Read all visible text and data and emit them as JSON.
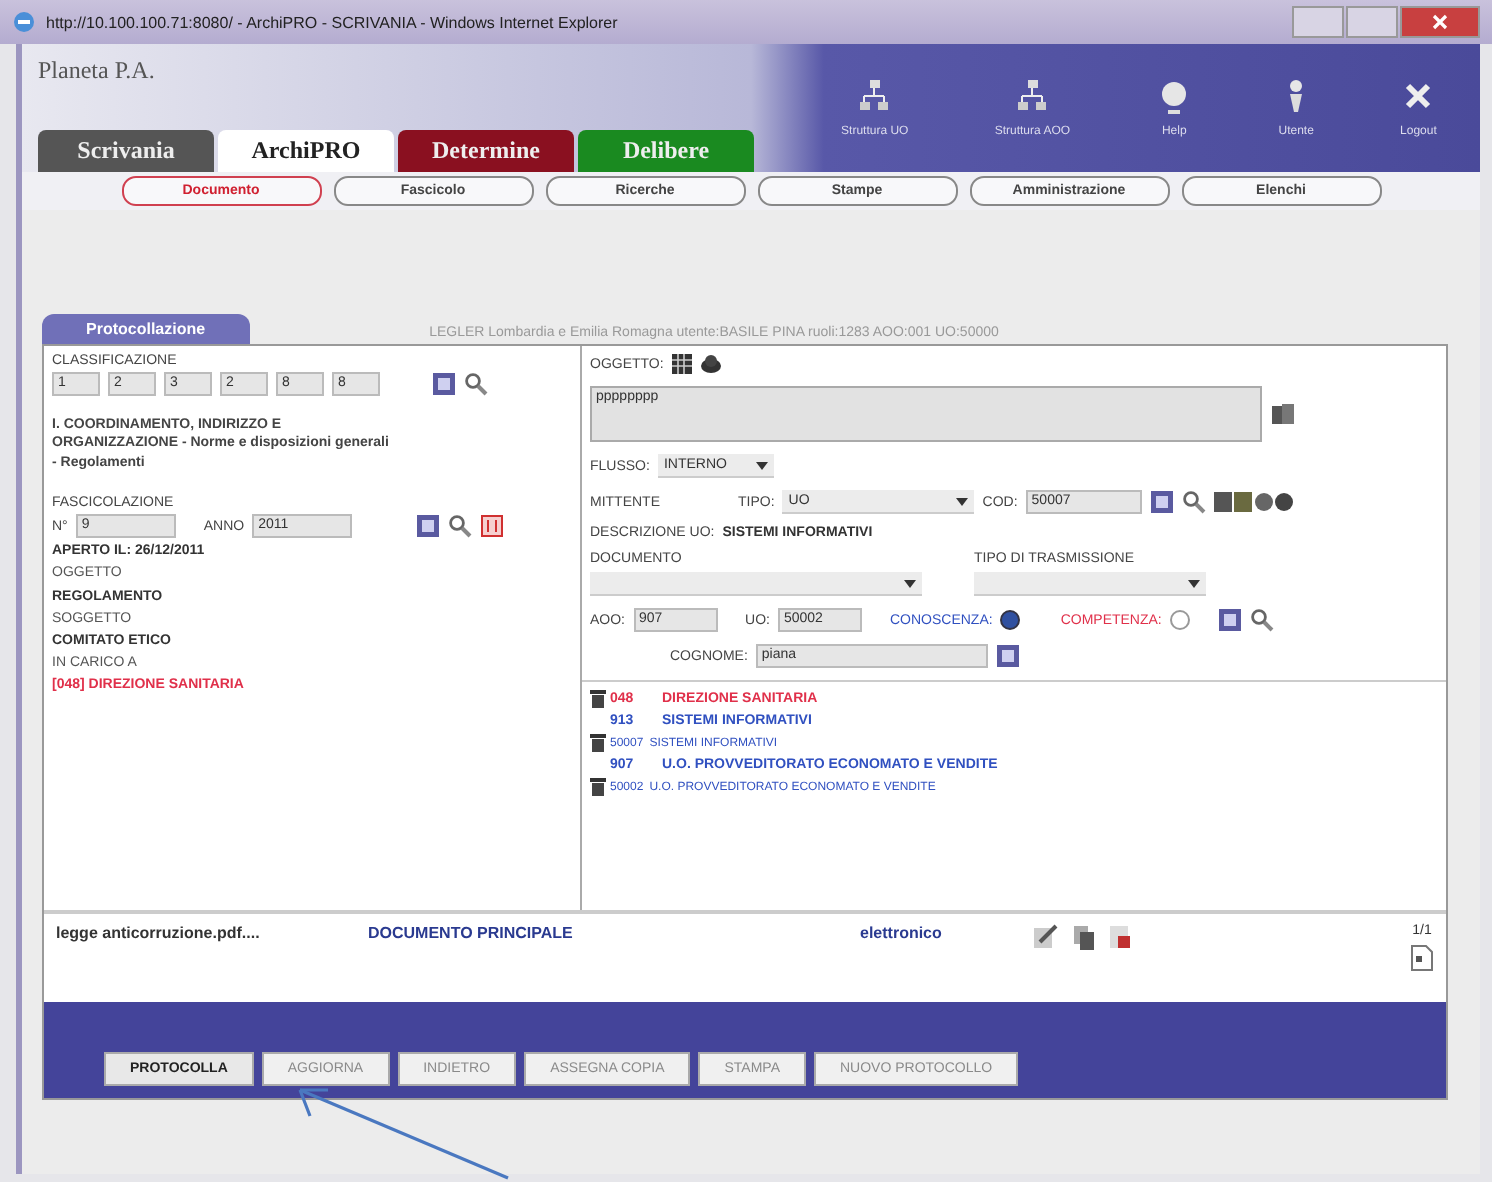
{
  "window": {
    "title": "http://10.100.100.71:8080/ - ArchiPRO - SCRIVANIA - Windows Internet Explorer"
  },
  "brand": "Planeta P.A.",
  "modules": [
    {
      "label": "Scrivania",
      "kind": "grey",
      "selected": false
    },
    {
      "label": "ArchiPRO",
      "kind": "grey",
      "selected": true
    },
    {
      "label": "Determine",
      "kind": "red",
      "selected": false
    },
    {
      "label": "Delibere",
      "kind": "green",
      "selected": false
    }
  ],
  "tools": [
    {
      "label": "Struttura UO",
      "kind": "tree"
    },
    {
      "label": "Struttura AOO",
      "kind": "tree"
    },
    {
      "label": "Help",
      "kind": "help"
    },
    {
      "label": "Utente",
      "kind": "user"
    },
    {
      "label": "Logout",
      "kind": "close"
    }
  ],
  "nav": [
    {
      "label": "Documento",
      "selected": true
    },
    {
      "label": "Fascicolo",
      "selected": false
    },
    {
      "label": "Ricerche",
      "selected": false
    },
    {
      "label": "Stampe",
      "selected": false
    },
    {
      "label": "Amministrazione",
      "selected": false
    },
    {
      "label": "Elenchi",
      "selected": false
    }
  ],
  "panel_tab": "Protocollazione",
  "info_line": "LEGLER Lombardia e Emilia Romagna  utente:BASILE PINA  ruoli:1283 AOO:001 UO:50000",
  "left": {
    "classificazione_label": "CLASSIFICAZIONE",
    "classificazione": [
      "1",
      "2",
      "3",
      "2",
      "8",
      "8"
    ],
    "classificazione_text": "I. COORDINAMENTO, INDIRIZZO E ORGANIZZAZIONE - Norme e disposizioni generali - Regolamenti",
    "fascicolazione_label": "FASCICOLAZIONE",
    "numero_label": "N°",
    "numero": "9",
    "anno_label": "ANNO",
    "anno": "2011",
    "details": [
      {
        "text": "APERTO IL: 26/12/2011",
        "kind": "bold"
      },
      {
        "text": "OGGETTO",
        "kind": "plain"
      },
      {
        "text": "REGOLAMENTO",
        "kind": "bold"
      },
      {
        "text": "SOGGETTO",
        "kind": "plain"
      },
      {
        "text": "COMITATO ETICO",
        "kind": "bold"
      },
      {
        "text": "IN CARICO A",
        "kind": "plain"
      },
      {
        "text": "[048] DIREZIONE SANITARIA",
        "kind": "alert"
      }
    ]
  },
  "right": {
    "oggetto_label": "OGGETTO:",
    "oggetto": "pppppppp",
    "flusso_label": "FLUSSO:",
    "flusso": "INTERNO",
    "mittente_label": "MITTENTE",
    "tipo_label": "TIPO:",
    "tipo": "UO",
    "cod_label": "COD:",
    "cod": "50007",
    "descrizione_label": "DESCRIZIONE UO:",
    "descrizione": "SISTEMI INFORMATIVI",
    "documento_label": "DOCUMENTO",
    "trasmissione_label": "TIPO DI TRASMISSIONE",
    "aoo_label": "AOO:",
    "aoo": "907",
    "uo_label": "UO:",
    "uo": "50002",
    "conoscenza_label": "CONOSCENZA:",
    "conoscenza": {
      "selected": true
    },
    "competenza_label": "COMPETENZA:",
    "competenza": {
      "selected": false
    },
    "cognome_label": "COGNOME:",
    "cognome": "piana",
    "recipients": [
      {
        "code": "048",
        "name": "DIREZIONE SANITARIA",
        "kind": "office",
        "deletable": true,
        "color": "#e0304a"
      },
      {
        "code": "913",
        "name": "SISTEMI INFORMATIVI",
        "kind": "office",
        "deletable": false,
        "color": "#3050c0"
      },
      {
        "code": "50007",
        "name": "SISTEMI INFORMATIVI",
        "kind": "unit",
        "deletable": true,
        "color": "#3050c0"
      },
      {
        "code": "907",
        "name": "U.O. PROVVEDITORATO ECONOMATO E VENDITE",
        "kind": "office",
        "deletable": false,
        "color": "#3050c0"
      },
      {
        "code": "50002",
        "name": "U.O. PROVVEDITORATO ECONOMATO E VENDITE",
        "kind": "unit",
        "deletable": true,
        "color": "#3050c0"
      }
    ]
  },
  "file": {
    "name": "legge anticorruzione.pdf....",
    "role": "DOCUMENTO PRINCIPALE",
    "type": "elettronico",
    "pages": "1/1"
  },
  "actions": [
    {
      "label": "PROTOCOLLA",
      "disabled": false
    },
    {
      "label": "AGGIORNA",
      "disabled": true
    },
    {
      "label": "INDIETRO",
      "disabled": true
    },
    {
      "label": "ASSEGNA COPIA",
      "disabled": true
    },
    {
      "label": "STAMPA",
      "disabled": true
    },
    {
      "label": "NUOVO PROTOCOLLO",
      "disabled": true
    }
  ]
}
